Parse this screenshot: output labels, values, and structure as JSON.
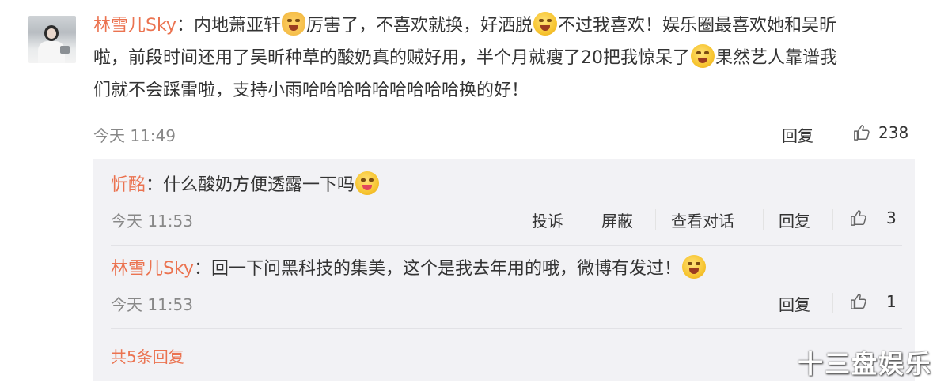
{
  "main_comment": {
    "author": "林雪儿Sky",
    "separator": "：",
    "line1_a": "内地萧亚轩",
    "line1_b": "厉害了，不喜欢就换，好洒脱",
    "line1_c": "不过我喜欢！娱乐圈最喜欢她和吴昕",
    "line2_a": "啦，前段时间还用了吴昕种草的酸奶真的贼好用，半个月就瘦了20把我惊呆了",
    "line2_b": "果然艺人靠谱我",
    "line3": "们就不会踩雷啦，支持小雨哈哈哈哈哈哈哈哈哈换的好！",
    "time": "今天 11:49",
    "reply_label": "回复",
    "likes": "238",
    "emojis": [
      "cat-face-emoji",
      "laugh-cry-emoji",
      "laugh-cry-emoji"
    ]
  },
  "replies": [
    {
      "author": "忻酩",
      "separator": "：",
      "text": "什么酸奶方便透露一下吗",
      "time": "今天 11:53",
      "report_label": "投诉",
      "block_label": "屏蔽",
      "view_conv_label": "查看对话",
      "reply_label": "回复",
      "likes": "3"
    },
    {
      "author": "林雪儿Sky",
      "separator": "：",
      "text": "回一下问黑科技的集美，这个是我去年用的哦，微博有发过！",
      "time": "今天 11:53",
      "reply_label": "回复",
      "likes": "1"
    }
  ],
  "more_replies": "共5条回复",
  "watermark": "十三盘娱乐",
  "colors": {
    "accent": "#eb7350",
    "meta": "#888888",
    "reply_bg": "#f2f2f5"
  }
}
